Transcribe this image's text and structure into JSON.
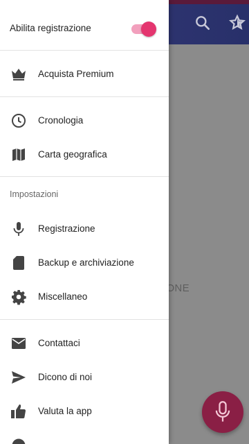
{
  "drawer": {
    "toggle_label": "Abilita registrazione",
    "toggle_on": true,
    "premium_label": "Acquista Premium",
    "history_label": "Cronologia",
    "map_label": "Carta geografica",
    "settings_section": "Impostazioni",
    "recording_label": "Registrazione",
    "backup_label": "Backup e archiviazione",
    "misc_label": "Miscellaneo",
    "contacts_label": "Contattaci",
    "share_label": "Dicono di noi",
    "rate_label": "Valuta la app"
  },
  "background": {
    "partial_text": "IONE"
  },
  "colors": {
    "accent": "#e4356f",
    "fab": "#8a1f45",
    "topbar": "#2e3470"
  },
  "icons": [
    "crown-icon",
    "clock-icon",
    "map-icon",
    "microphone-icon",
    "sd-card-icon",
    "gear-icon",
    "mail-icon",
    "send-icon",
    "thumbs-up-icon",
    "search-icon",
    "star-icon"
  ]
}
